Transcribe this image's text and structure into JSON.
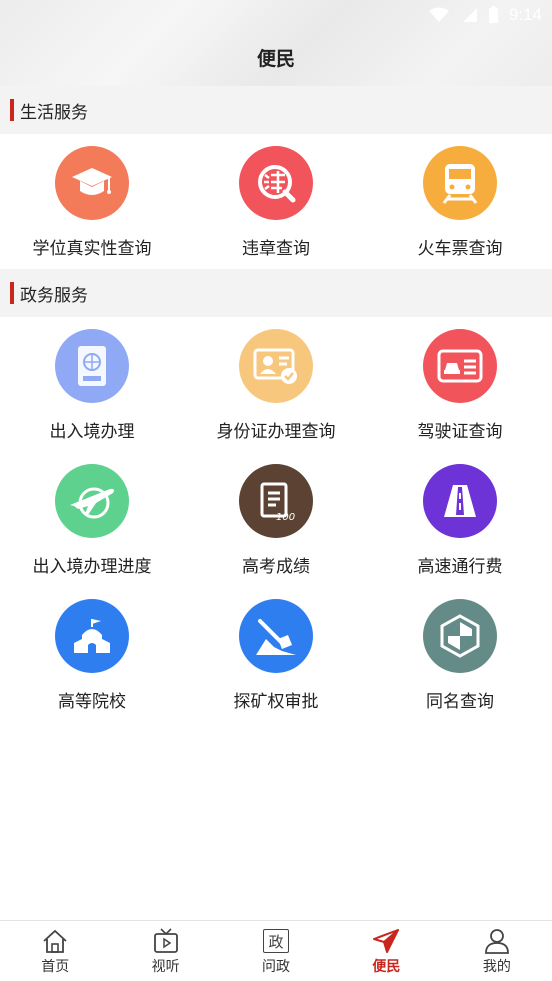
{
  "status": {
    "time": "9:14"
  },
  "header": {
    "title": "便民"
  },
  "sections": [
    {
      "title": "生活服务",
      "items": [
        {
          "label": "学位真实性查询",
          "icon": "graduation-cap-icon",
          "color": "#f47b5a"
        },
        {
          "label": "违章查询",
          "icon": "traffic-violation-icon",
          "color": "#f2545b"
        },
        {
          "label": "火车票查询",
          "icon": "train-icon",
          "color": "#f7ad3d"
        }
      ]
    },
    {
      "title": "政务服务",
      "items": [
        {
          "label": "出入境办理",
          "icon": "passport-icon",
          "color": "#8fa9f5"
        },
        {
          "label": "身份证办理查询",
          "icon": "id-card-icon",
          "color": "#f7c77d"
        },
        {
          "label": "驾驶证查询",
          "icon": "driver-license-icon",
          "color": "#f2545b"
        },
        {
          "label": "出入境办理进度",
          "icon": "airplane-icon",
          "color": "#5ed18f"
        },
        {
          "label": "高考成绩",
          "icon": "exam-score-icon",
          "color": "#5b4232"
        },
        {
          "label": "高速通行费",
          "icon": "highway-icon",
          "color": "#6d33d6"
        },
        {
          "label": "高等院校",
          "icon": "university-icon",
          "color": "#2f7ef0"
        },
        {
          "label": "探矿权审批",
          "icon": "mining-shovel-icon",
          "color": "#2f7ef0"
        },
        {
          "label": "同名查询",
          "icon": "same-name-icon",
          "color": "#648b87"
        }
      ]
    }
  ],
  "tabbar": {
    "items": [
      {
        "label": "首页",
        "icon": "home-icon"
      },
      {
        "label": "视听",
        "icon": "tv-icon"
      },
      {
        "label": "问政",
        "icon": "politics-icon",
        "glyph": "政"
      },
      {
        "label": "便民",
        "icon": "send-icon",
        "active": true
      },
      {
        "label": "我的",
        "icon": "user-icon"
      }
    ],
    "active_color": "#c8261e"
  }
}
